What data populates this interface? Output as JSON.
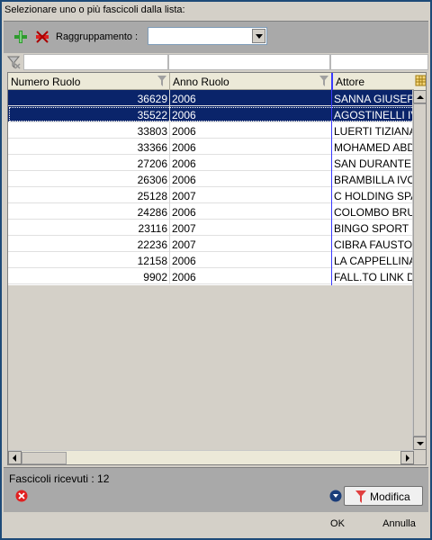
{
  "prompt": "Selezionare uno o più fascicoli dalla lista:",
  "toolbar": {
    "add_icon": "add-green-icon",
    "remove_icon": "remove-red-icon",
    "group_label": "Raggruppamento :",
    "group_value": ""
  },
  "grid": {
    "columns": [
      "Numero Ruolo",
      "Anno Ruolo",
      "Attore"
    ],
    "rows": [
      {
        "numero": "36629",
        "anno": "2006",
        "attore": "SANNA GIUSEP"
      },
      {
        "numero": "35522",
        "anno": "2006",
        "attore": "AGOSTINELLI IV"
      },
      {
        "numero": "33803",
        "anno": "2006",
        "attore": "LUERTI TIZIANA"
      },
      {
        "numero": "33366",
        "anno": "2006",
        "attore": "MOHAMED ABDI"
      },
      {
        "numero": "27206",
        "anno": "2006",
        "attore": "SAN DURANTE"
      },
      {
        "numero": "26306",
        "anno": "2006",
        "attore": "BRAMBILLA IVO"
      },
      {
        "numero": "25128",
        "anno": "2007",
        "attore": "C HOLDING SPA"
      },
      {
        "numero": "24286",
        "anno": "2006",
        "attore": "COLOMBO BRU"
      },
      {
        "numero": "23116",
        "anno": "2007",
        "attore": "BINGO SPORT S"
      },
      {
        "numero": "22236",
        "anno": "2007",
        "attore": "CIBRA FAUSTO"
      },
      {
        "numero": "12158",
        "anno": "2006",
        "attore": "LA CAPPELLINA"
      },
      {
        "numero": "9902",
        "anno": "2006",
        "attore": "FALL.TO LINK D"
      }
    ]
  },
  "status": {
    "received": "Fascicoli ricevuti : 12",
    "modify_label": "Modifica"
  },
  "footer": {
    "ok_label": "OK",
    "cancel_label": "Annulla"
  },
  "colors": {
    "selection": "#0a246a",
    "panel": "#a9a9a9",
    "window_border": "#1d4a78"
  }
}
